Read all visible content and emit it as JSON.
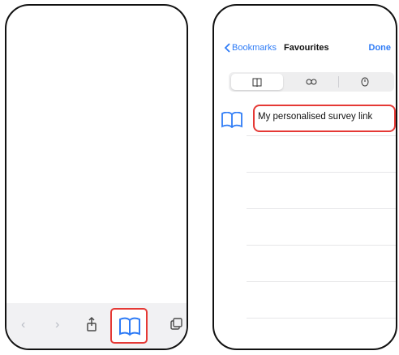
{
  "colors": {
    "accent": "#2f7cf6",
    "highlight": "#e53935"
  },
  "left_phone": {
    "toolbar": {
      "back_icon": "chevron-left-icon",
      "forward_icon": "chevron-right-icon",
      "share_icon": "share-icon",
      "bookmarks_icon": "book-icon",
      "tabs_icon": "tabs-icon"
    }
  },
  "right_phone": {
    "nav": {
      "back_label": "Bookmarks",
      "title": "Favourites",
      "done_label": "Done"
    },
    "segments": [
      {
        "icon": "book-icon",
        "selected": true
      },
      {
        "icon": "reading-list-icon",
        "selected": false
      },
      {
        "icon": "history-icon",
        "selected": false
      }
    ],
    "bookmarks": [
      {
        "label": "My personalised survey link",
        "icon": "book-icon"
      }
    ]
  }
}
